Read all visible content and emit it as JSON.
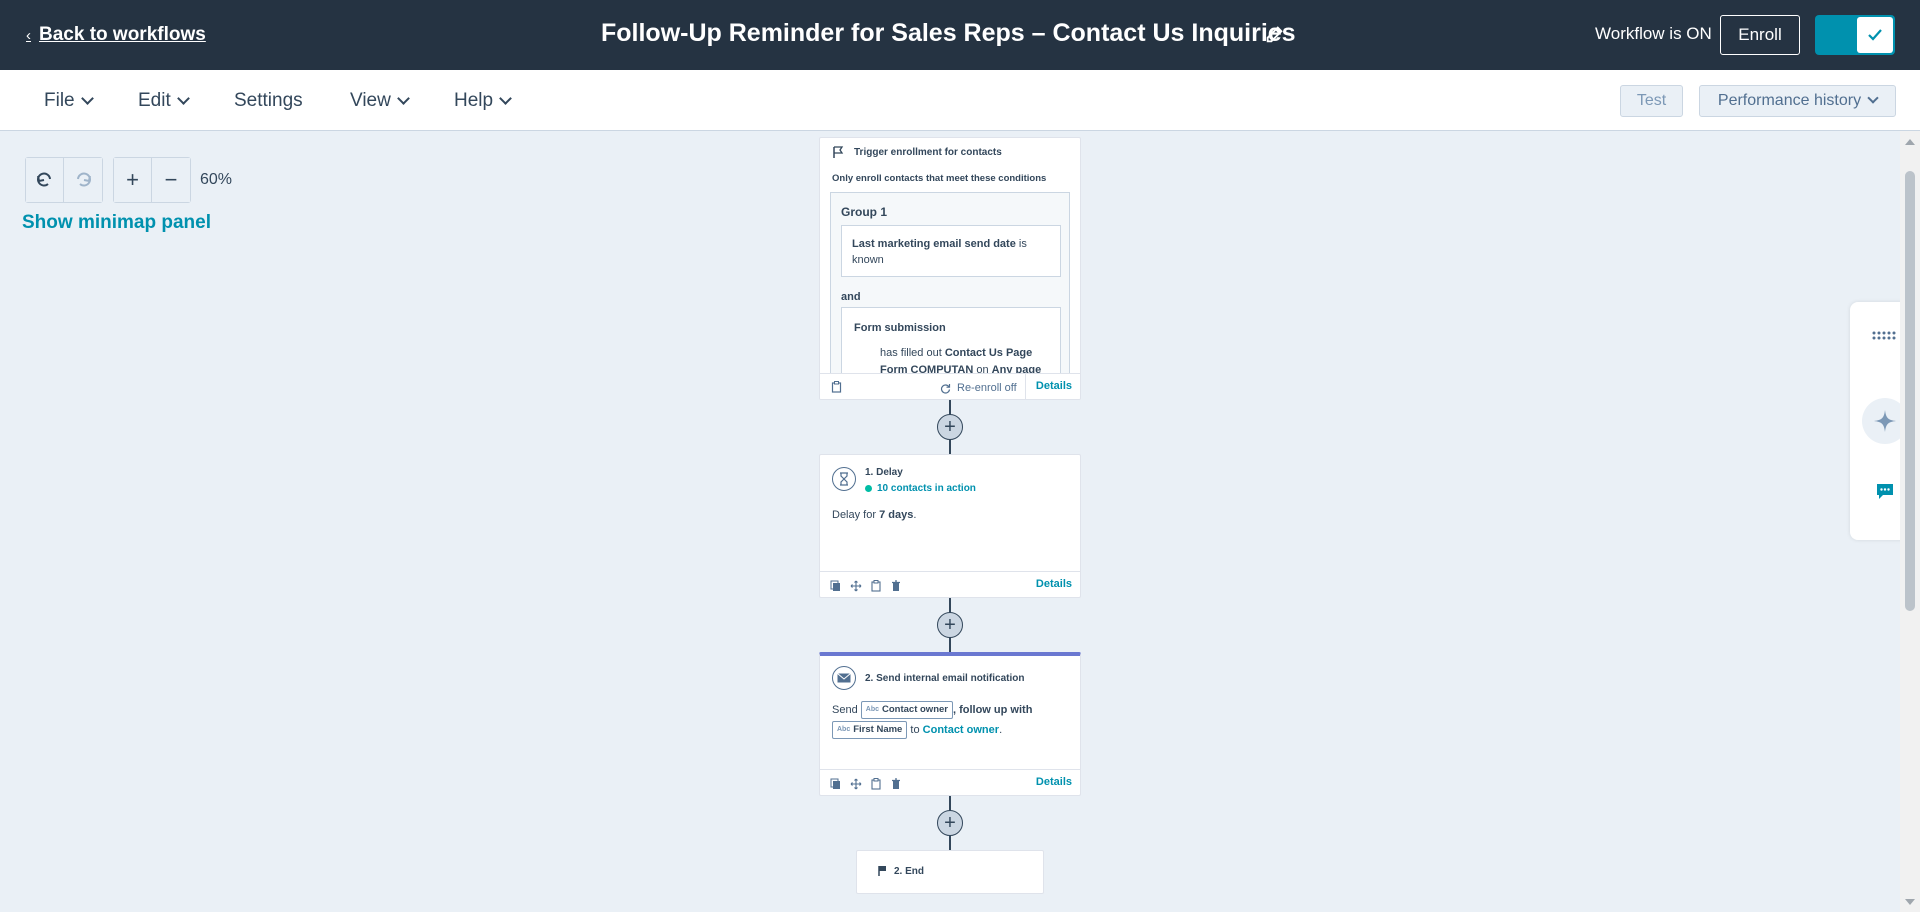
{
  "header": {
    "back_label": "Back to workflows",
    "title": "Follow-Up Reminder for Sales Reps – Contact Us Inquiries",
    "status": "Workflow is ON",
    "enroll_label": "Enroll"
  },
  "menu": {
    "items": [
      {
        "label": "File"
      },
      {
        "label": "Edit"
      },
      {
        "label": "Settings"
      },
      {
        "label": "View"
      },
      {
        "label": "Help"
      }
    ],
    "test_label": "Test",
    "performance_label": "Performance history"
  },
  "canvas": {
    "zoom": "60%",
    "minimap_label": "Show minimap panel"
  },
  "trigger": {
    "title": "Trigger enrollment for contacts",
    "subtitle": "Only enroll contacts that meet these conditions",
    "group_title": "Group 1",
    "cond1_prop": "Last marketing email send date",
    "cond1_op": "is known",
    "and_label": "and",
    "cond2_title": "Form submission",
    "cond2_pre": "has filled out",
    "cond2_form": "Contact Us Page Form COMPUTAN",
    "cond2_on": "on",
    "cond2_page": "Any page",
    "reenroll": "Re-enroll off",
    "details": "Details"
  },
  "steps": [
    {
      "title": "1. Delay",
      "status": "10 contacts in action",
      "body_pre": "Delay for",
      "body_value": "7 days",
      "body_post": ".",
      "details": "Details"
    },
    {
      "title": "2. Send internal email notification",
      "send": "Send",
      "token1": "Contact owner",
      "mid": ", follow up with",
      "token2": "First Name",
      "to": "to",
      "recipient": "Contact owner",
      "end_punct": ".",
      "details": "Details"
    }
  ],
  "end": {
    "label": "2. End"
  },
  "colors": {
    "topbar": "#253342",
    "accent": "#0091ae",
    "canvas": "#eaf0f6",
    "active_card": "#6a78d1"
  }
}
